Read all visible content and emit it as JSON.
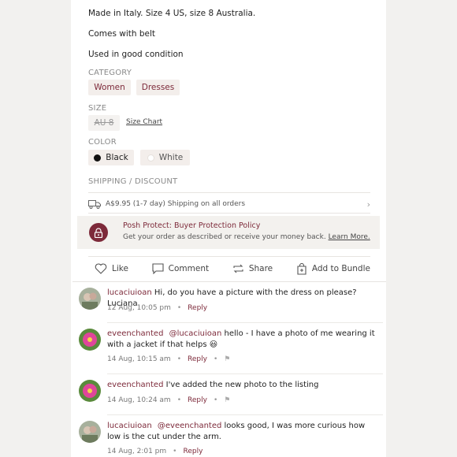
{
  "description": {
    "line1": "Made in Italy. Size 4 US, size 8 Australia.",
    "line2": "Comes with belt",
    "line3": "Used in good condition"
  },
  "category": {
    "title": "CATEGORY",
    "chips": [
      "Women",
      "Dresses"
    ]
  },
  "size": {
    "title": "SIZE",
    "value": "AU 8",
    "chart_link": "Size Chart"
  },
  "color": {
    "title": "COLOR",
    "options": [
      {
        "label": "Black",
        "swatch": "#111111"
      },
      {
        "label": "White",
        "swatch": "#ffffff"
      }
    ]
  },
  "shipping": {
    "title": "SHIPPING / DISCOUNT",
    "price": "A$9.95 (1-7 day) Shipping on all orders"
  },
  "protect": {
    "title": "Posh Protect: Buyer Protection Policy",
    "text": "Get your order as described or receive your money back.",
    "link": "Learn More."
  },
  "actions": {
    "like": "Like",
    "comment": "Comment",
    "share": "Share",
    "bundle": "Add to Bundle"
  },
  "comments": [
    {
      "user": "lucaciuioan",
      "text": "Hi, do you have a picture with the dress on please? Luciana",
      "time": "12 Aug, 10:05 pm",
      "reply": "Reply"
    },
    {
      "user": "eveenchanted",
      "mention": "@lucaciuioan",
      "text": "hello - I have a photo of me wearing it with a jacket if that helps",
      "emoji": "😃",
      "time": "14 Aug, 10:15 am",
      "reply": "Reply"
    },
    {
      "user": "eveenchanted",
      "text": "I've added the new photo to the listing",
      "time": "14 Aug, 10:24 am",
      "reply": "Reply"
    },
    {
      "user": "lucaciuioan",
      "mention": "@eveenchanted",
      "text": "looks good, I was more curious how low is the cut under the arm.",
      "time": "14 Aug, 2:01 pm",
      "reply": "Reply"
    }
  ],
  "colors": {
    "accent": "#7d2a3a",
    "chip_bg": "#f3eeeb",
    "protect_bg": "#f3f1ee"
  }
}
